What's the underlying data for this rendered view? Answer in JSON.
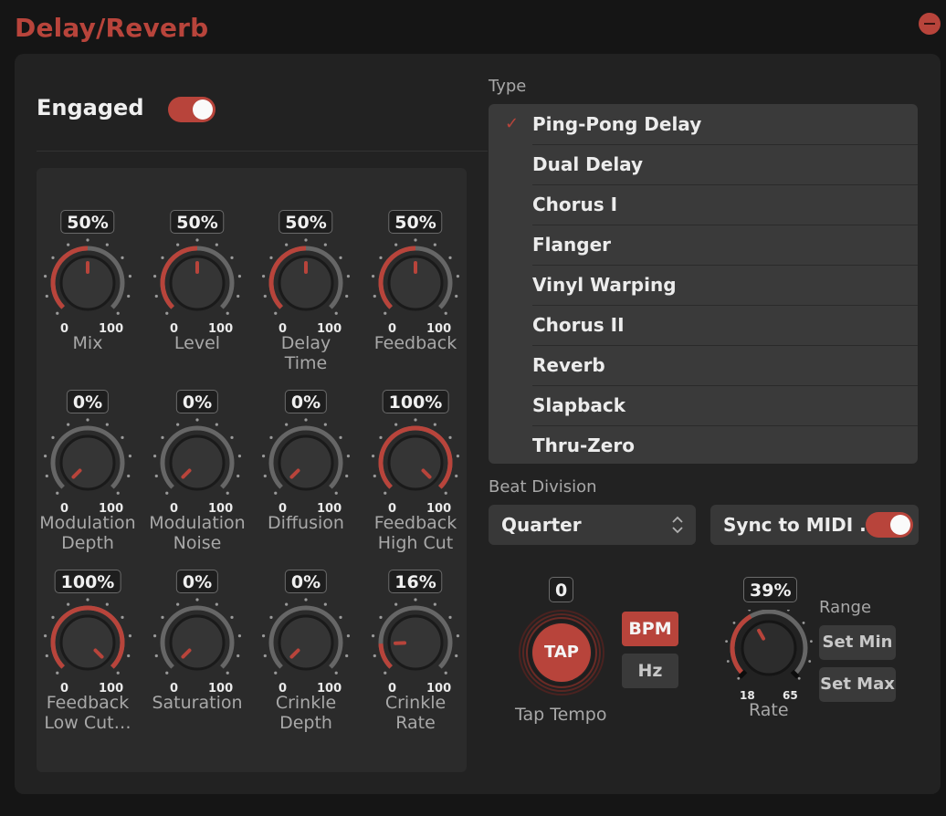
{
  "window": {
    "title": "Delay/Reverb",
    "accent_color": "#b8443b"
  },
  "engaged": {
    "label": "Engaged",
    "on": true
  },
  "knobs": [
    {
      "value": "50%",
      "min": "0",
      "max": "100",
      "label": "Mix",
      "fraction": 0.5
    },
    {
      "value": "50%",
      "min": "0",
      "max": "100",
      "label": "Level",
      "fraction": 0.5
    },
    {
      "value": "50%",
      "min": "0",
      "max": "100",
      "label": "Delay\nTime",
      "fraction": 0.5
    },
    {
      "value": "50%",
      "min": "0",
      "max": "100",
      "label": "Feedback",
      "fraction": 0.5
    },
    {
      "value": "0%",
      "min": "0",
      "max": "100",
      "label": "Modulation\nDepth",
      "fraction": 0
    },
    {
      "value": "0%",
      "min": "0",
      "max": "100",
      "label": "Modulation\nNoise",
      "fraction": 0
    },
    {
      "value": "0%",
      "min": "0",
      "max": "100",
      "label": "Diffusion",
      "fraction": 0
    },
    {
      "value": "100%",
      "min": "0",
      "max": "100",
      "label": "Feedback\nHigh Cut",
      "fraction": 1
    },
    {
      "value": "100%",
      "min": "0",
      "max": "100",
      "label": "Feedback\nLow Cut…",
      "fraction": 1
    },
    {
      "value": "0%",
      "min": "0",
      "max": "100",
      "label": "Saturation",
      "fraction": 0
    },
    {
      "value": "0%",
      "min": "0",
      "max": "100",
      "label": "Crinkle\nDepth",
      "fraction": 0
    },
    {
      "value": "16%",
      "min": "0",
      "max": "100",
      "label": "Crinkle\nRate",
      "fraction": 0.16
    }
  ],
  "type": {
    "label": "Type",
    "selected_index": 0,
    "options": [
      "Ping-Pong Delay",
      "Dual Delay",
      "Chorus I",
      "Flanger",
      "Vinyl Warping",
      "Chorus II",
      "Reverb",
      "Slapback",
      "Thru-Zero"
    ],
    "check_icon": "checkmark-icon"
  },
  "beat_division": {
    "label": "Beat Division",
    "value": "Quarter",
    "icon": "up-down-chevron-icon"
  },
  "sync_midi": {
    "label": "Sync to MIDI ...",
    "on": true
  },
  "tap_tempo": {
    "value": "0",
    "button_label": "TAP",
    "label": "Tap Tempo"
  },
  "units": {
    "bpm_label": "BPM",
    "hz_label": "Hz",
    "selected": "BPM"
  },
  "rate": {
    "value": "39%",
    "fraction": 0.39,
    "min": "18",
    "max": "65",
    "label": "Rate"
  },
  "range": {
    "label": "Range",
    "set_min_label": "Set Min",
    "set_max_label": "Set Max"
  }
}
